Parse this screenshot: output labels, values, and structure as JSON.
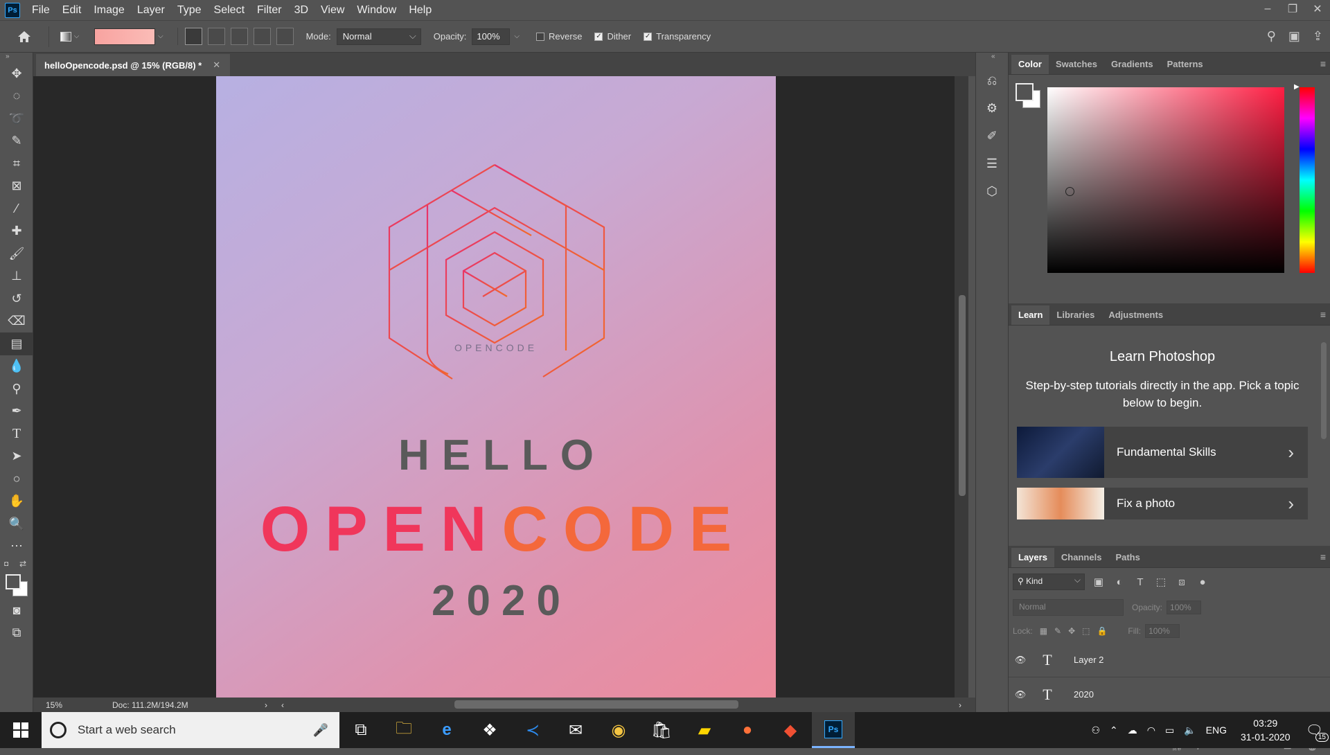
{
  "app": {
    "logo": "Ps"
  },
  "menu": [
    "File",
    "Edit",
    "Image",
    "Layer",
    "Type",
    "Select",
    "Filter",
    "3D",
    "View",
    "Window",
    "Help"
  ],
  "window_controls": {
    "minimize": "–",
    "restore": "❐",
    "close": "✕"
  },
  "options": {
    "mode_label": "Mode:",
    "mode_value": "Normal",
    "opacity_label": "Opacity:",
    "opacity_value": "100%",
    "reverse_label": "Reverse",
    "reverse_checked": false,
    "dither_label": "Dither",
    "dither_checked": true,
    "transparency_label": "Transparency",
    "transparency_checked": true,
    "gradient_colors": [
      "#f8a3a0",
      "#fbbcb7"
    ]
  },
  "document": {
    "tab_title": "helloOpencode.psd @ 15% (RGB/8) *",
    "zoom": "15%",
    "doc_info": "Doc: 111.2M/194.2M"
  },
  "artwork": {
    "logo_text": "OPENCODE",
    "line1": "HELLO",
    "line2_part1": "OPEN",
    "line2_part2": "CODE",
    "line3": "2020",
    "colors": {
      "pink": "#f0365b",
      "orange": "#f4683b",
      "gray": "#5a5a5a"
    }
  },
  "color_panel": {
    "tabs": [
      "Color",
      "Swatches",
      "Gradients",
      "Patterns"
    ],
    "active_tab": "Color",
    "hue_color": "#ff1e43"
  },
  "learn_panel": {
    "tabs": [
      "Learn",
      "Libraries",
      "Adjustments"
    ],
    "title": "Learn Photoshop",
    "subtitle": "Step-by-step tutorials directly in the app. Pick a topic below to begin.",
    "cards": [
      {
        "label": "Fundamental Skills"
      },
      {
        "label": "Fix a photo"
      }
    ]
  },
  "layers_panel": {
    "tabs": [
      "Layers",
      "Channels",
      "Paths"
    ],
    "filter_kind": "Kind",
    "blend_mode": "Normal",
    "opacity_label": "Opacity:",
    "opacity_value": "100%",
    "lock_label": "Lock:",
    "fill_label": "Fill:",
    "fill_value": "100%",
    "layers": [
      {
        "name": "Layer 2",
        "type_icon": "T"
      },
      {
        "name": "2020",
        "type_icon": "T"
      }
    ]
  },
  "taskbar": {
    "search_placeholder": "Start a web search",
    "language": "ENG",
    "time": "03:29",
    "date": "31-01-2020",
    "notification_count": "15"
  }
}
